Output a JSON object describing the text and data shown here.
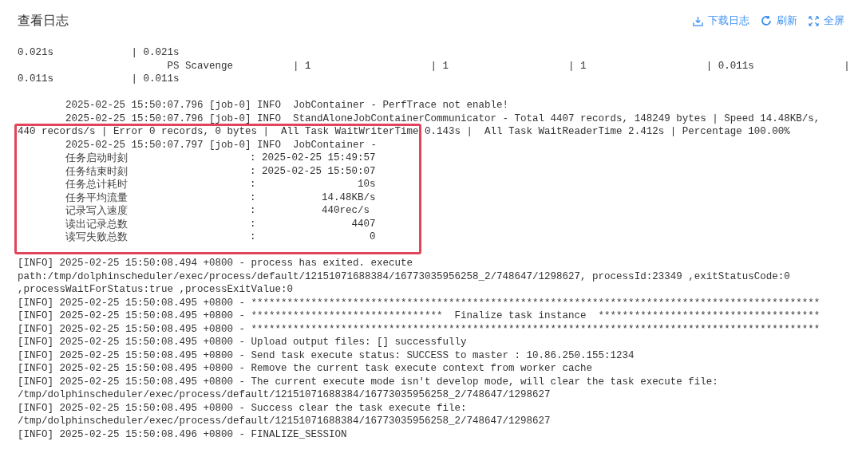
{
  "title": "查看日志",
  "actions": [
    {
      "kind": "download",
      "label": "下载日志"
    },
    {
      "kind": "refresh",
      "label": "刷新"
    },
    {
      "kind": "fullscreen",
      "label": "全屏"
    }
  ],
  "log": {
    "before": [
      "0.021s             | 0.021s",
      "                         PS Scavenge          | 1                    | 1                    | 1                    | 0.011s               |",
      "0.011s             | 0.011s"
    ],
    "job_lines": [
      "        2025-02-25 15:50:07.796 [job-0] INFO  JobContainer - PerfTrace not enable!",
      "        2025-02-25 15:50:07.796 [job-0] INFO  StandAloneJobContainerCommunicator - Total 4407 records, 148249 bytes | Speed 14.48KB/s,"
    ],
    "highlighted": [
      {
        "kind": "line",
        "text": "440 records/s | Error 0 records, 0 bytes |  All Task WaitWriterTime 0.143s |  All Task WaitReaderTime 2.412s | Percentage 100.00%"
      },
      {
        "kind": "line",
        "text": "        2025-02-25 15:50:07.797 [job-0] INFO  JobContainer - "
      },
      {
        "kind": "stat",
        "label": "任务启动时刻",
        "value": ": 2025-02-25 15:49:57"
      },
      {
        "kind": "stat",
        "label": "任务结束时刻",
        "value": ": 2025-02-25 15:50:07"
      },
      {
        "kind": "stat",
        "label": "任务总计耗时",
        "value": ":                 10s"
      },
      {
        "kind": "stat",
        "label": "任务平均流量",
        "value": ":           14.48KB/s"
      },
      {
        "kind": "stat",
        "label": "记录写入速度",
        "value": ":           440rec/s"
      },
      {
        "kind": "stat",
        "label": "读出记录总数",
        "value": ":                4407"
      },
      {
        "kind": "stat",
        "label": "读写失败总数",
        "value": ":                   0"
      }
    ],
    "after": [
      "[INFO] 2025-02-25 15:50:08.494 +0800 - process has exited. execute",
      "path:/tmp/dolphinscheduler/exec/process/default/12151071688384/16773035956258_2/748647/1298627, processId:23349 ,exitStatusCode:0",
      ",processWaitForStatus:true ,processExitValue:0",
      "[INFO] 2025-02-25 15:50:08.495 +0800 - ***********************************************************************************************",
      "[INFO] 2025-02-25 15:50:08.495 +0800 - ********************************  Finalize task instance  *************************************",
      "[INFO] 2025-02-25 15:50:08.495 +0800 - ***********************************************************************************************",
      "[INFO] 2025-02-25 15:50:08.495 +0800 - Upload output files: [] successfully",
      "[INFO] 2025-02-25 15:50:08.495 +0800 - Send task execute status: SUCCESS to master : 10.86.250.155:1234",
      "[INFO] 2025-02-25 15:50:08.495 +0800 - Remove the current task execute context from worker cache",
      "[INFO] 2025-02-25 15:50:08.495 +0800 - The current execute mode isn't develop mode, will clear the task execute file:",
      "/tmp/dolphinscheduler/exec/process/default/12151071688384/16773035956258_2/748647/1298627",
      "[INFO] 2025-02-25 15:50:08.495 +0800 - Success clear the task execute file:",
      "/tmp/dolphinscheduler/exec/process/default/12151071688384/16773035956258_2/748647/1298627",
      "[INFO] 2025-02-25 15:50:08.496 +0800 - FINALIZE_SESSION"
    ]
  }
}
